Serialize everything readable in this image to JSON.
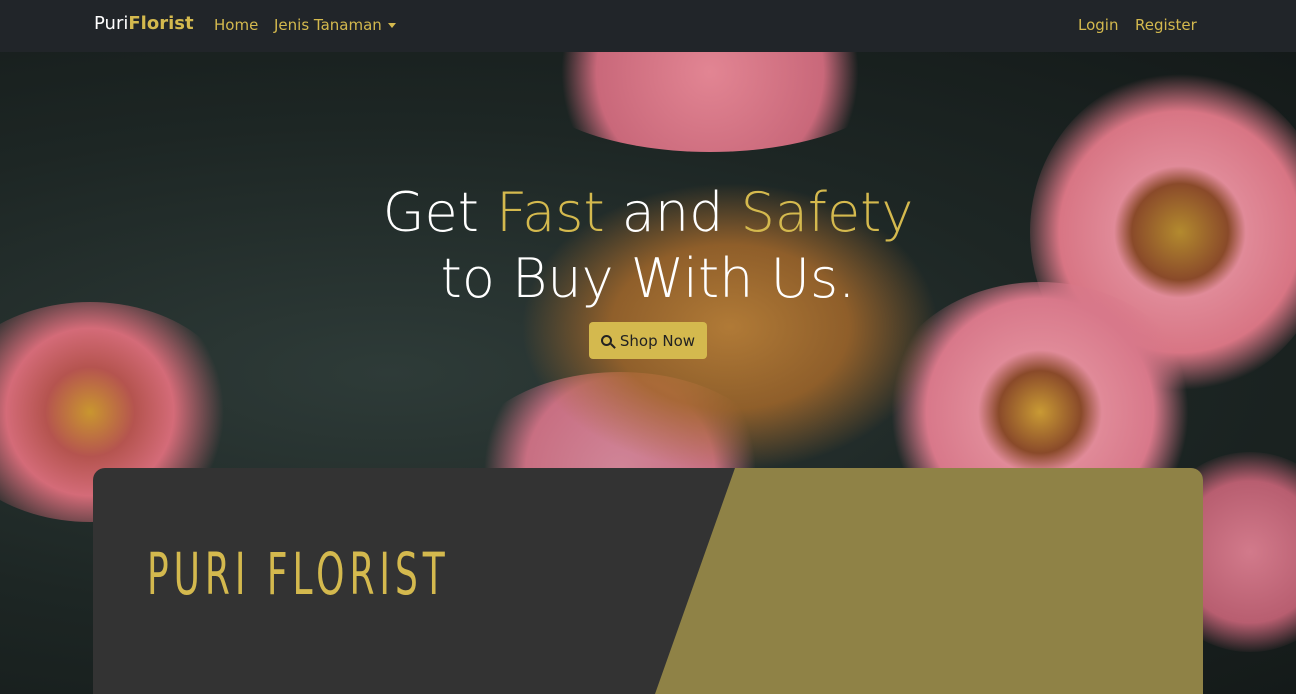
{
  "navbar": {
    "brand_prefix": "Puri",
    "brand_suffix": "Florist",
    "links": {
      "home": "Home",
      "jenis": "Jenis Tanaman",
      "login": "Login",
      "register": "Register"
    }
  },
  "hero": {
    "line1": {
      "w1": "Get ",
      "w2": "Fast",
      "w3": " and ",
      "w4": "Safety"
    },
    "line2": "to Buy With Us.",
    "button_label": "Shop Now",
    "button_icon": "search-icon"
  },
  "banner": {
    "logo_text": "PURI FLORIST"
  },
  "colors": {
    "accent": "#d4b94e",
    "navbar": "#212529",
    "banner_dark": "#333333",
    "banner_gold": "#8f8246"
  }
}
